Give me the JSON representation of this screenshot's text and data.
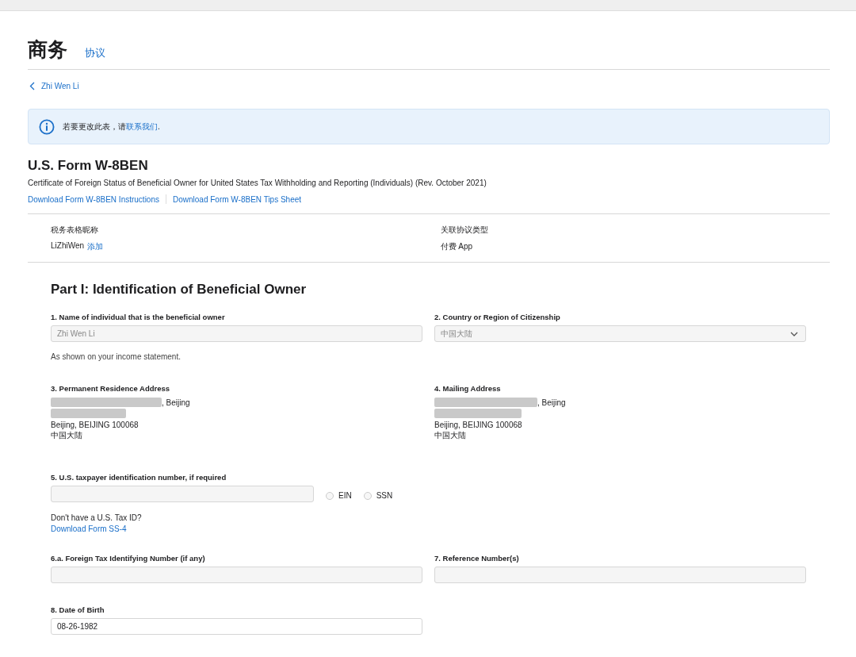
{
  "header": {
    "title": "商务",
    "tab": "协议"
  },
  "back_link": "Zhi Wen Li",
  "notice": {
    "text": "若要更改此表，请**联系我们**."
  },
  "form": {
    "title": "U.S. Form W-8BEN",
    "subtitle": "Certificate of Foreign Status of Beneficial Owner for United States Tax Withholding and Reporting (Individuals) (Rev. October 2021)",
    "links": [
      "Download Form W-8BEN Instructions",
      "Download Form W-8BEN Tips Sheet"
    ]
  },
  "meta": [
    {
      "label": "税务表格昵称",
      "value": "LiZhiWen",
      "action": "添加"
    },
    {
      "label": "关联协议类型",
      "value": "付费 App"
    }
  ],
  "part_title": "Part I: Identification of Beneficial Owner",
  "name_field": {
    "label": "1. Name of individual that is the beneficial owner",
    "value": "Zhi Wen Li",
    "disabled": true,
    "hint": "As shown on your income statement."
  },
  "citizenship": {
    "label": "2. Country or Region of Citizenship",
    "value": "中国大陆",
    "disabled": true
  },
  "addresses": [
    {
      "label": "3. Permanent Residence Address",
      "lines": [
        ", Beijing",
        "Beijing, BEIJING 100068",
        "中国大陆"
      ]
    },
    {
      "label": "4. Mailing Address",
      "lines": [
        ", Beijing",
        "Beijing, BEIJING 100068",
        "中国大陆"
      ]
    }
  ],
  "tin": {
    "label": "5. U.S. taxpayer identification number, if required",
    "options": [
      {
        "label": "EIN",
        "selected": false
      },
      {
        "label": "SSN",
        "selected": false
      }
    ],
    "note": "Don't have a U.S. Tax ID?",
    "link": "Download Form SS-4"
  },
  "foreign_tin": {
    "label": "6.a. Foreign Tax Identifying Number (if any)"
  },
  "reference": {
    "label": "7. Reference Number(s)"
  },
  "dob": {
    "label": "8. Date of Birth",
    "value": "08-26-1982"
  }
}
